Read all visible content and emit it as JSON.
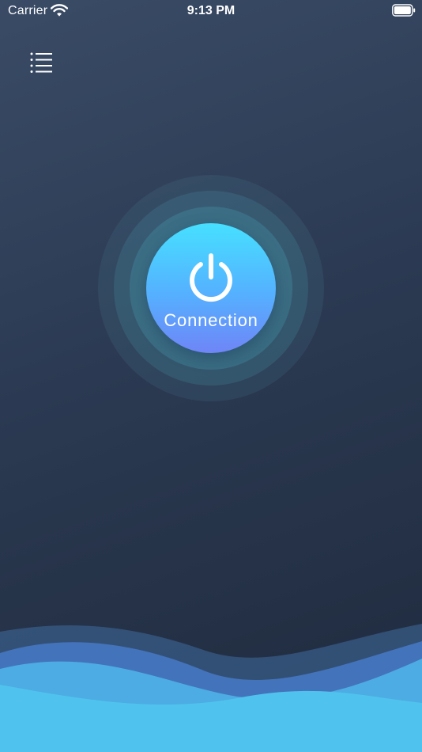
{
  "status_bar": {
    "carrier": "Carrier",
    "time": "9:13 PM",
    "wifi_icon": "wifi-icon",
    "battery_icon": "battery-icon"
  },
  "menu": {
    "icon": "list-menu-icon"
  },
  "connect": {
    "label": "Connection",
    "icon": "power-icon",
    "colors": {
      "gradient_top": "#46e0ff",
      "gradient_bottom": "#6f85f7",
      "ring": "#468c9f"
    }
  },
  "colors": {
    "background_top": "#3a4b66",
    "background_bottom": "#1f2a3d",
    "wave_light": "#4fc3ee",
    "wave_dark": "#4a7fd1"
  }
}
